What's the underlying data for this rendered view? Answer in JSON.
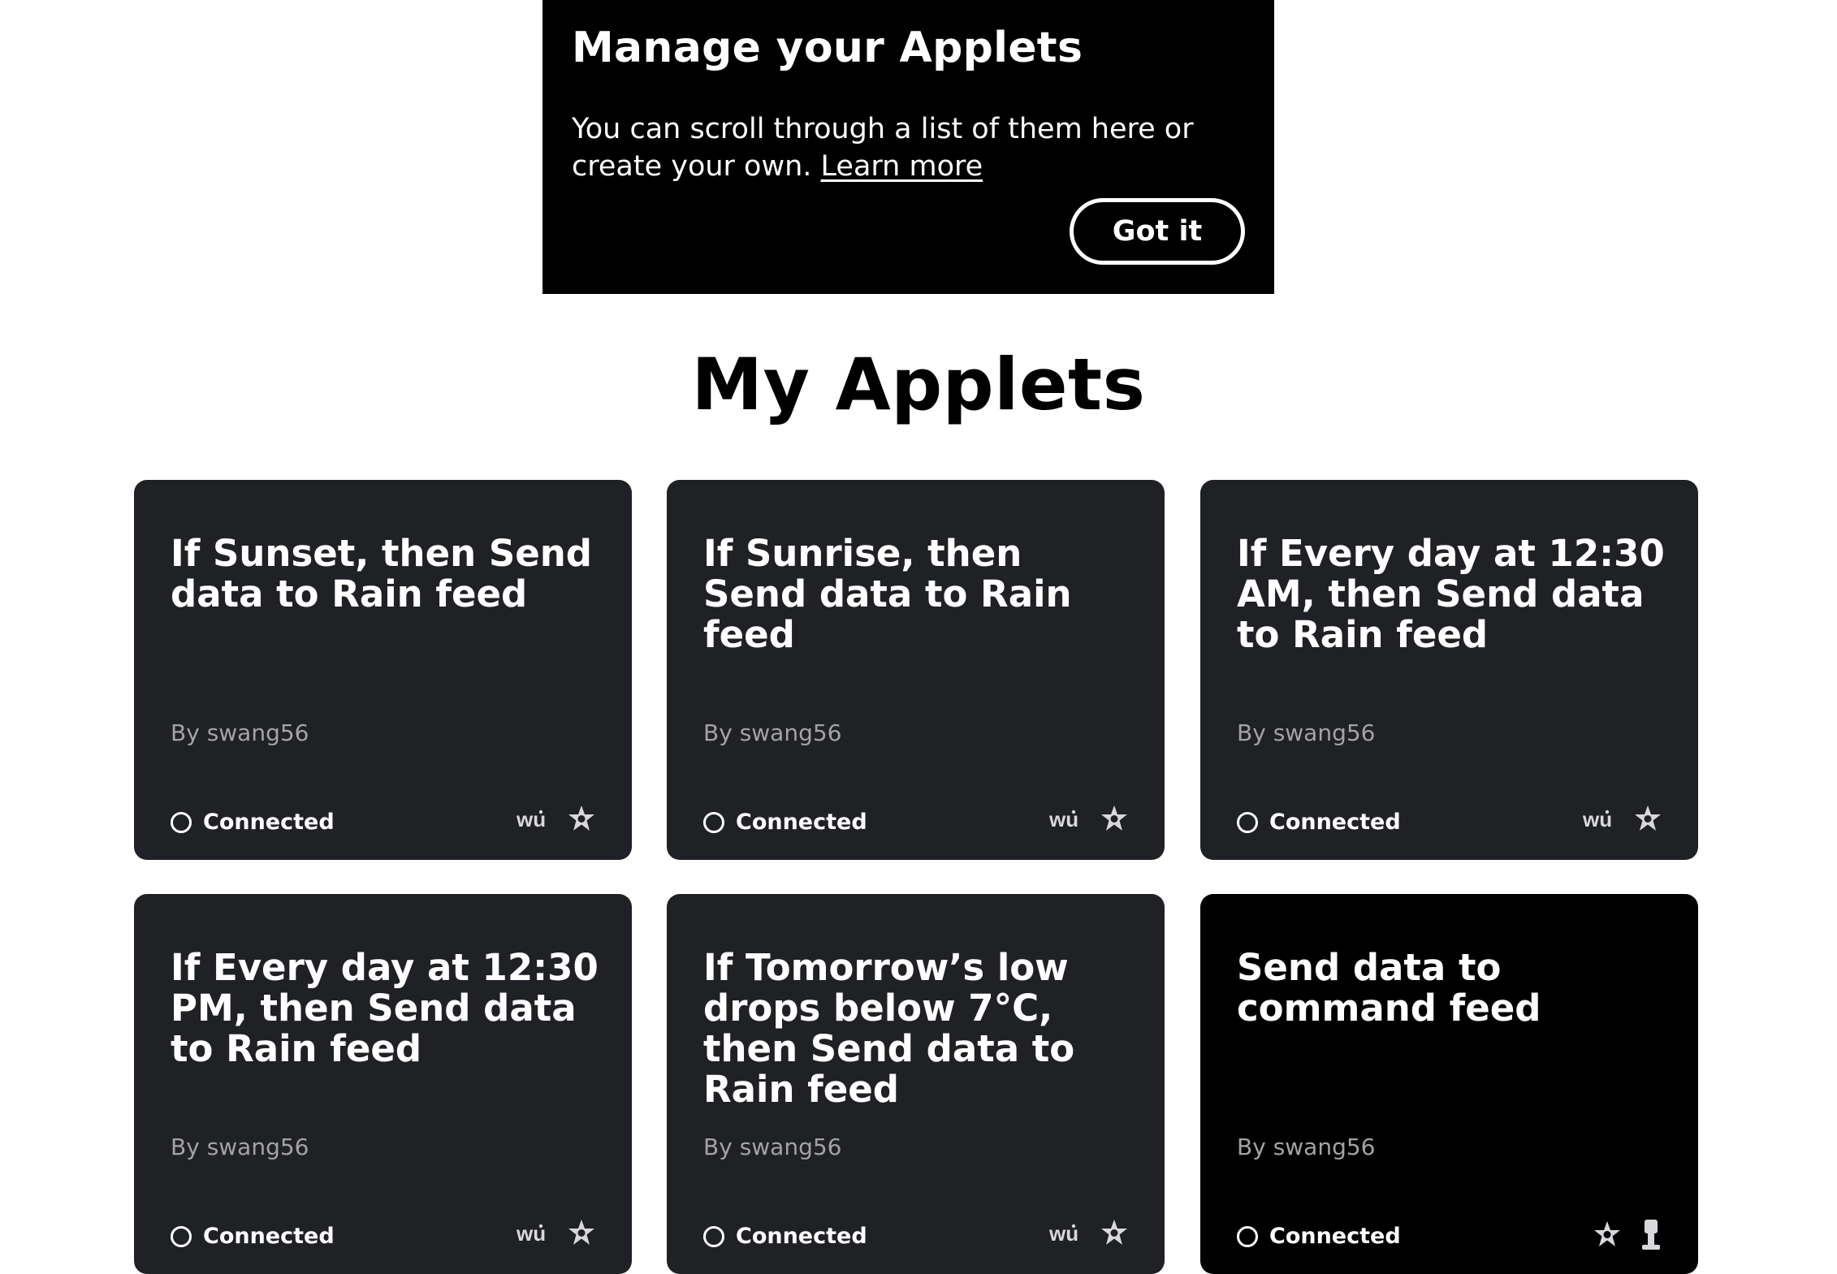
{
  "tip": {
    "title": "Manage your Applets",
    "text": "You can scroll through a list of them here or create your own.",
    "link": "Learn more",
    "button": "Got it"
  },
  "page_title": "My Applets",
  "applets": [
    {
      "title": "If Sunset, then Send data to Rain feed",
      "by": "By",
      "author": "swang56",
      "status": "Connected",
      "icons": [
        "wu-icon",
        "adafruit-star-icon"
      ]
    },
    {
      "title": "If Sunrise, then Send data to Rain feed",
      "by": "By",
      "author": "swang56",
      "status": "Connected",
      "icons": [
        "wu-icon",
        "adafruit-star-icon"
      ]
    },
    {
      "title": "If Every day at 12:30 AM, then Send data to Rain feed",
      "by": "By",
      "author": "swang56",
      "status": "Connected",
      "icons": [
        "wu-icon",
        "adafruit-star-icon"
      ]
    },
    {
      "title": "If Every day at 12:30 PM, then Send data to Rain feed",
      "by": "By",
      "author": "swang56",
      "status": "Connected",
      "icons": [
        "wu-icon",
        "adafruit-star-icon"
      ]
    },
    {
      "title": "If Tomorrow’s low drops below 7°C, then Send data to Rain feed",
      "by": "By",
      "author": "swang56",
      "status": "Connected",
      "icons": [
        "wu-icon",
        "adafruit-star-icon"
      ]
    },
    {
      "title": "Send data to command feed",
      "by": "By",
      "author": "swang56",
      "status": "Connected",
      "icons": [
        "adafruit-star-icon",
        "button-widget-icon"
      ]
    }
  ],
  "colors": {
    "card": "#202125",
    "card_dark": "#000000",
    "tip": "#000000",
    "author_text": "#a3a3a7"
  }
}
